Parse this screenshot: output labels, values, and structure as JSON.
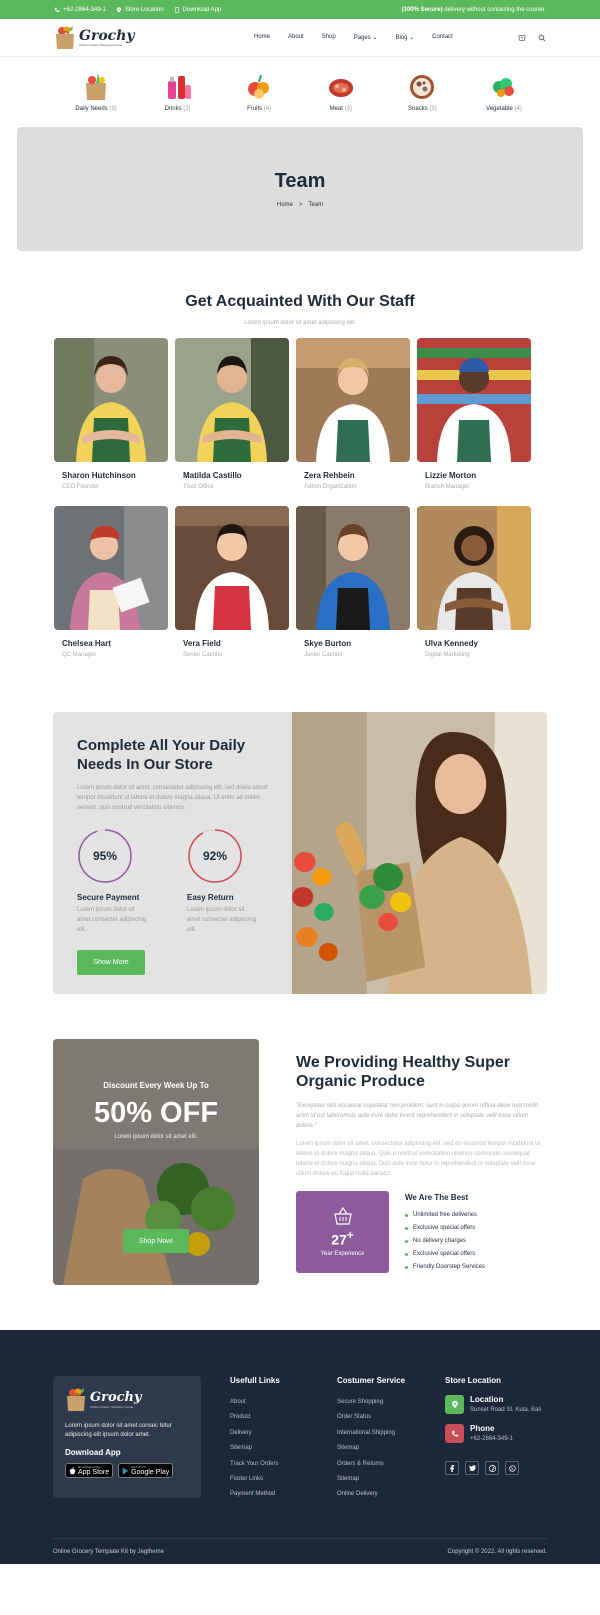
{
  "topbar": {
    "phone": "+62-2864-349-1",
    "store_location": "Store Location",
    "download_app": "Download App",
    "secure_bold": "(100% Secure)",
    "secure_text": "delivery without contacting the courier."
  },
  "brand": {
    "name": "Grochy",
    "tagline": "Online Grocery Shopping Center"
  },
  "nav": {
    "items": [
      {
        "label": "Home"
      },
      {
        "label": "About"
      },
      {
        "label": "Shop"
      },
      {
        "label": "Pages"
      },
      {
        "label": "Blog"
      },
      {
        "label": "Contact"
      }
    ]
  },
  "categories": [
    {
      "label": "Daily Needs",
      "count": "(3)",
      "icon": "grocery-bag-icon"
    },
    {
      "label": "Drinks",
      "count": "(3)",
      "icon": "drinks-icon"
    },
    {
      "label": "Fruits",
      "count": "(4)",
      "icon": "fruits-icon"
    },
    {
      "label": "Meat",
      "count": "(3)",
      "icon": "meat-icon"
    },
    {
      "label": "Snacks",
      "count": "(3)",
      "icon": "snacks-icon"
    },
    {
      "label": "Vegetable",
      "count": "(4)",
      "icon": "vegetable-icon"
    }
  ],
  "banner": {
    "title": "Team",
    "crumb_home": "Home",
    "crumb_sep": ">",
    "crumb_current": "Team"
  },
  "staff": {
    "title": "Get Acquainted With Our Staff",
    "subtitle": "Lorem ipsum dolor sit amet adipiscing elit.",
    "members": [
      {
        "name": "Sharon Hutchinson",
        "role": "CEO Founder"
      },
      {
        "name": "Matilda Castillo",
        "role": "Trust Office"
      },
      {
        "name": "Zera Rehbein",
        "role": "Admin Organization"
      },
      {
        "name": "Lizzie Morton",
        "role": "Branch Manager"
      },
      {
        "name": "Chelsea Hart",
        "role": "QC Manager"
      },
      {
        "name": "Vera Field",
        "role": "Senior Cashier"
      },
      {
        "name": "Skye Burton",
        "role": "Junior Cashier"
      },
      {
        "name": "Ulva Kennedy",
        "role": "Digital Marketing"
      }
    ]
  },
  "daily": {
    "title": "Complete All Your Daily Needs In Our Store",
    "text": "Lorem ipsum dolor sit amet, consectetur adipiscing elit, sed doeiu smod tempor incididunt ut labore et dolore magna aliqua. Ut enim ad minim veniam, quis nostrud vercitation ullamco .",
    "stats": [
      {
        "value": "95%",
        "fraction": 0.95,
        "title": "Secure Payment",
        "text": "Lorem ipsum dolor sit amet consectet adipiscing elit.",
        "color": "#8d5b9c"
      },
      {
        "value": "92%",
        "fraction": 0.92,
        "title": "Easy Return",
        "text": "Lorem ipsum dolor sit amet consectet adipiscing elit.",
        "color": "#c94d55"
      }
    ],
    "button": "Show More"
  },
  "promo": {
    "kicker": "Discount Every Week Up To",
    "big": "50% OFF",
    "small": "Lorem ipsum dolor sit amet elit.",
    "button": "Shop Now!",
    "title": "We Providing Healthy Super Organic Produce",
    "quote": "\"Excepteur sint occaecat cupidatat non proident, sunt in culpa quiore officia dese runt mollit anim id est laborumuis aute irure dolor inrerit reprehenderit in voluptate velit esse cillum dolore.\"",
    "text": "Lorem ipsum dolor sit amet, consectetur adipiscing elit, sed do eiusmod tempor incididunt ut labore et dolore magna aliqua. Quis a nostrud exercitation ullamco commodo consequat labore et dolore magna aliqua. Duis aute irure dolor in reprehenderit in voluptate velit esse cillum dolore eu fugiat nulla pariatur.",
    "experience_value": "27",
    "experience_plus": "+",
    "experience_label": "Year Experience",
    "best_title": "We Are The Best",
    "best_items": [
      "Unlimited free deliveries",
      "Exclusive special offers",
      "No delivery charges",
      "Exclusive special offers",
      "Friendly Doorstep Services"
    ]
  },
  "footer": {
    "text": "Lorem ipsum dolor sit amet consec tetur adipiscing elit ipsum dolor amet.",
    "download": "Download App",
    "appstore_small": "Download on the",
    "appstore": "App Store",
    "gplay_small": "GET IT ON",
    "gplay": "Google Play",
    "links_title": "Usefull Links",
    "links": [
      "About",
      "Product",
      "Delivery",
      "Sitemap",
      "Track Your Orders",
      "Footer Links",
      "Payment Method"
    ],
    "service_title": "Costumer Service",
    "service": [
      "Secure Shopping",
      "Order Status",
      "International Shipping",
      "Sitemap",
      "Orders & Returns",
      "Sitemap",
      "Online Delivery"
    ],
    "store_title": "Store Location",
    "location_label": "Location",
    "location_value": "Sunset Road St. Kuta, Bali",
    "phone_label": "Phone",
    "phone_value": "+62-2864-349-1",
    "copyright_left": "Online Grocery Template Kit by Jegtheme",
    "copyright_right": "Copyright © 2022. All rights reserved."
  },
  "colors": {
    "green": "#5cb85c",
    "navy": "#1c2739",
    "purple": "#8d5b9c",
    "red": "#c94d55"
  }
}
